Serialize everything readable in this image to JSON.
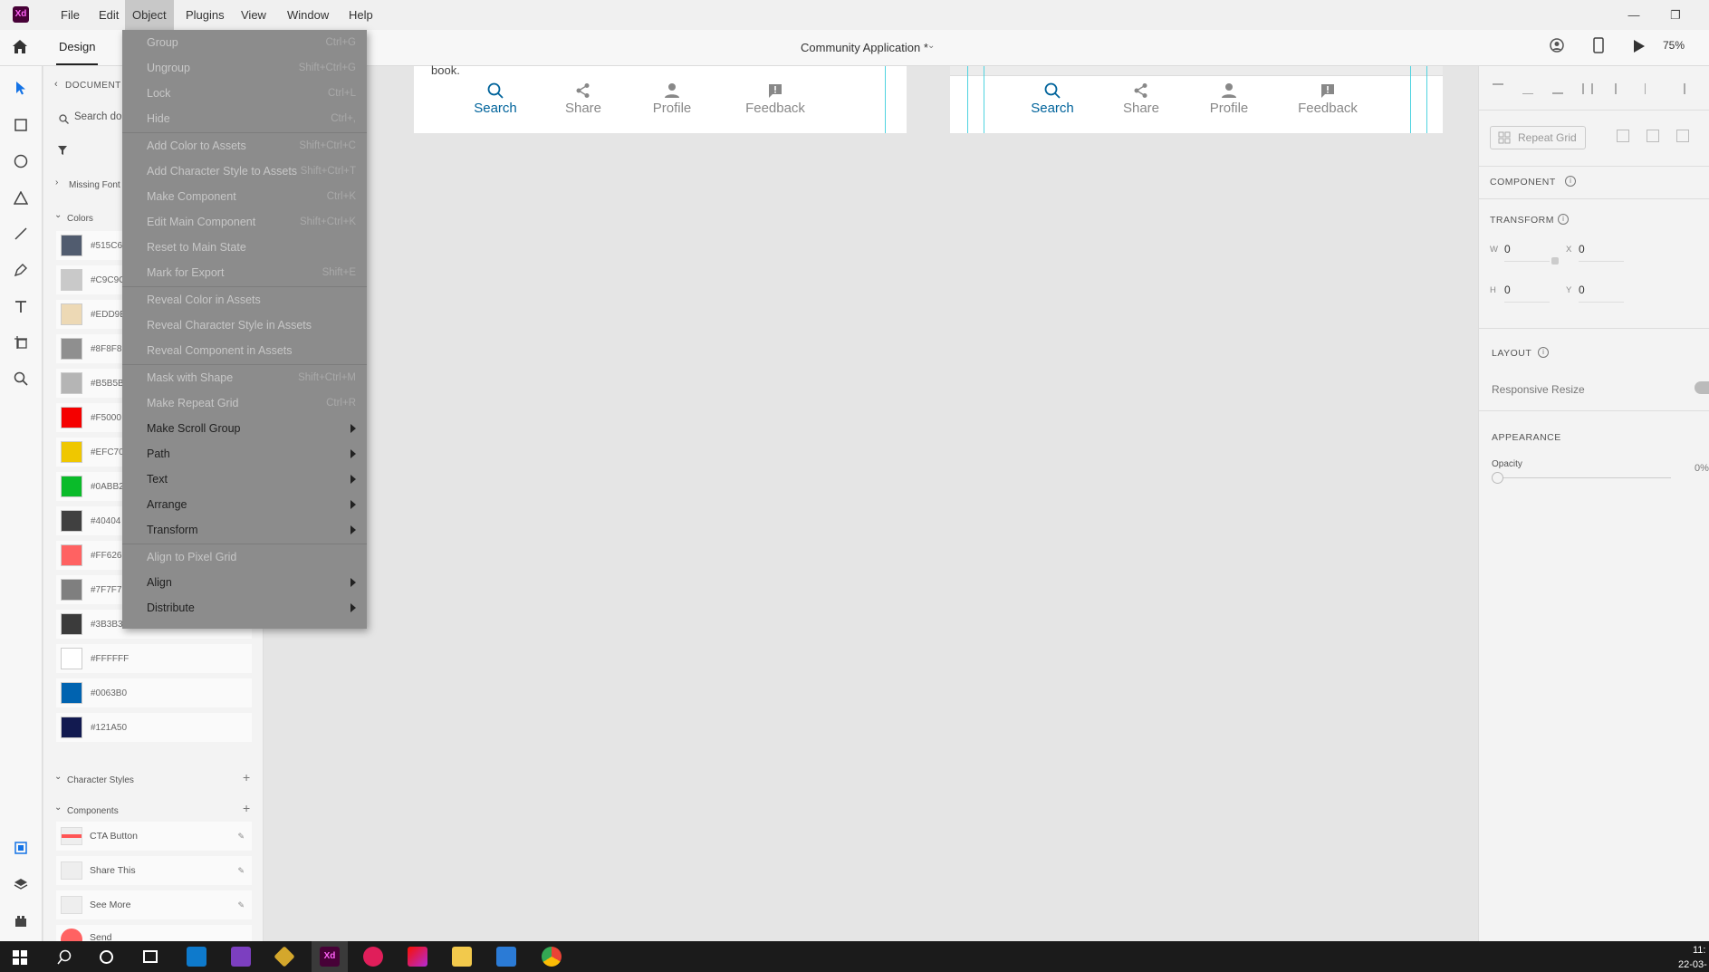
{
  "menubar": {
    "logo": "Xd",
    "items": [
      "File",
      "Edit",
      "Object",
      "Plugins",
      "View",
      "Window",
      "Help"
    ],
    "active": "Object"
  },
  "topbar": {
    "tab": "Design",
    "doc_title": "Community Application *",
    "zoom": "75%"
  },
  "assets": {
    "back_label": "DOCUMENT",
    "search_placeholder": "Search do",
    "missing_fonts": "Missing Font",
    "colors_label": "Colors",
    "colors": [
      {
        "hex": "#515C6F",
        "label": "#515C6"
      },
      {
        "hex": "#C9C9C9",
        "label": "#C9C9C"
      },
      {
        "hex": "#EDD9B5",
        "label": "#EDD9E"
      },
      {
        "hex": "#8F8F8F",
        "label": "#8F8F8"
      },
      {
        "hex": "#B5B5B5",
        "label": "#B5B5B"
      },
      {
        "hex": "#F50000",
        "label": "#F5000"
      },
      {
        "hex": "#EFC700",
        "label": "#EFC70"
      },
      {
        "hex": "#0ABB2A",
        "label": "#0ABB2"
      },
      {
        "hex": "#404040",
        "label": "#40404"
      },
      {
        "hex": "#FF6262",
        "label": "#FF626"
      },
      {
        "hex": "#7F7F7F",
        "label": "#7F7F7"
      },
      {
        "hex": "#3B3B3B",
        "label": "#3B3B3B"
      },
      {
        "hex": "#FFFFFF",
        "label": "#FFFFFF"
      },
      {
        "hex": "#0063B0",
        "label": "#0063B0"
      },
      {
        "hex": "#121A50",
        "label": "#121A50"
      }
    ],
    "char_styles_label": "Character Styles",
    "components_label": "Components",
    "components": [
      "CTA Button",
      "Share This",
      "See More",
      "Send"
    ]
  },
  "canvas": {
    "fragment_text": "book.",
    "nav": [
      "Search",
      "Share",
      "Profile",
      "Feedback"
    ]
  },
  "object_menu": [
    {
      "label": "Group",
      "shortcut": "Ctrl+G",
      "enabled": false
    },
    {
      "label": "Ungroup",
      "shortcut": "Shift+Ctrl+G",
      "enabled": false
    },
    {
      "label": "Lock",
      "shortcut": "Ctrl+L",
      "enabled": false
    },
    {
      "label": "Hide",
      "shortcut": "Ctrl+,",
      "enabled": false,
      "sep_after": true
    },
    {
      "label": "Add Color to Assets",
      "shortcut": "Shift+Ctrl+C",
      "enabled": false
    },
    {
      "label": "Add Character Style to Assets",
      "shortcut": "Shift+Ctrl+T",
      "enabled": false
    },
    {
      "label": "Make Component",
      "shortcut": "Ctrl+K",
      "enabled": false
    },
    {
      "label": "Edit Main Component",
      "shortcut": "Shift+Ctrl+K",
      "enabled": false
    },
    {
      "label": "Reset to Main State",
      "shortcut": "",
      "enabled": false
    },
    {
      "label": "Mark for Export",
      "shortcut": "Shift+E",
      "enabled": false,
      "sep_after": true
    },
    {
      "label": "Reveal Color in Assets",
      "shortcut": "",
      "enabled": false
    },
    {
      "label": "Reveal Character Style in Assets",
      "shortcut": "",
      "enabled": false
    },
    {
      "label": "Reveal Component in Assets",
      "shortcut": "",
      "enabled": false,
      "sep_after": true
    },
    {
      "label": "Mask with Shape",
      "shortcut": "Shift+Ctrl+M",
      "enabled": false
    },
    {
      "label": "Make Repeat Grid",
      "shortcut": "Ctrl+R",
      "enabled": false
    },
    {
      "label": "Make Scroll Group",
      "shortcut": "",
      "enabled": true,
      "submenu": true
    },
    {
      "label": "Path",
      "shortcut": "",
      "enabled": true,
      "submenu": true
    },
    {
      "label": "Text",
      "shortcut": "",
      "enabled": true,
      "submenu": true
    },
    {
      "label": "Arrange",
      "shortcut": "",
      "enabled": true,
      "submenu": true
    },
    {
      "label": "Transform",
      "shortcut": "",
      "enabled": true,
      "submenu": true,
      "sep_after": true
    },
    {
      "label": "Align to Pixel Grid",
      "shortcut": "",
      "enabled": false
    },
    {
      "label": "Align",
      "shortcut": "",
      "enabled": true,
      "submenu": true
    },
    {
      "label": "Distribute",
      "shortcut": "",
      "enabled": true,
      "submenu": true
    }
  ],
  "properties": {
    "repeat_grid": "Repeat Grid",
    "component": "COMPONENT",
    "transform": "TRANSFORM",
    "w_label": "W",
    "w": "0",
    "x_label": "X",
    "x": "0",
    "h_label": "H",
    "h": "0",
    "y_label": "Y",
    "y": "0",
    "layout": "LAYOUT",
    "responsive": "Responsive Resize",
    "appearance": "APPEARANCE",
    "opacity_label": "Opacity",
    "opacity": "0%"
  },
  "taskbar": {
    "time": "11:",
    "date": "22-03-"
  }
}
